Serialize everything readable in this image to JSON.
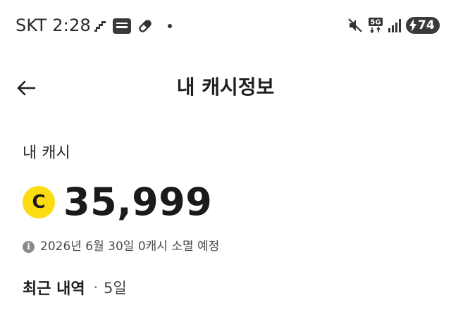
{
  "status_bar": {
    "carrier": "SKT",
    "time": "2:28",
    "app_icons": [
      "stairs-icon",
      "my-samsung-fire-app-icon",
      "pill-icon"
    ],
    "network": "5G",
    "battery": "74"
  },
  "header": {
    "title": "내 캐시정보"
  },
  "cash": {
    "label": "내 캐시",
    "coin_symbol": "C",
    "amount": "35,999",
    "expire_notice": "2026년 6월 30일 0캐시 소멸 예정"
  },
  "recent": {
    "title": "최근 내역",
    "separator": "·",
    "period": "5일"
  },
  "colors": {
    "coin": "#fbdc13",
    "text": "#1a1a1a"
  }
}
